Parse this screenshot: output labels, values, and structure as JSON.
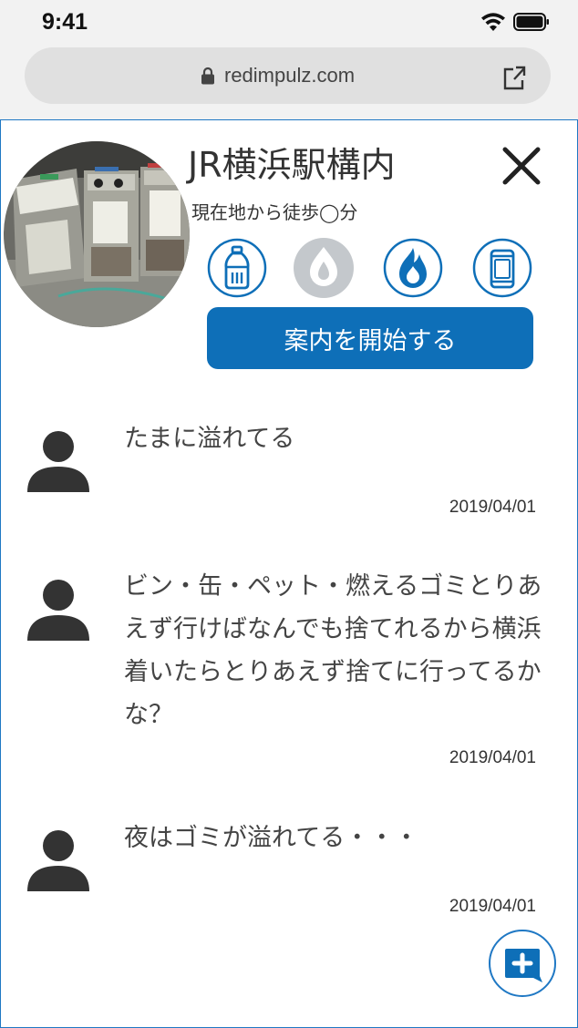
{
  "status_bar": {
    "time": "9:41",
    "icons": [
      "wifi-icon",
      "battery-icon"
    ]
  },
  "browser": {
    "url": "redimpulz.com",
    "icons": [
      "lock-icon",
      "share-icon"
    ]
  },
  "spot": {
    "name": "JR横浜駅構内",
    "walk_time": "現在地から徒歩◯分",
    "photo_icon": "trash-bins-photo",
    "trash_types": [
      {
        "icon": "pet-bottle-icon",
        "available": true
      },
      {
        "icon": "non-burnable-icon",
        "available": false
      },
      {
        "icon": "burnable-icon",
        "available": true
      },
      {
        "icon": "can-icon",
        "available": true
      }
    ],
    "start_button": "案内を開始する",
    "colors": {
      "accent": "#0e6fb8",
      "inactive": "#c4c8cc",
      "border": "#1f78c4"
    }
  },
  "reviews": [
    {
      "text": "たまに溢れてる",
      "date": "2019/04/01"
    },
    {
      "text": "ビン・缶・ペット・燃えるゴミとりあえず行けばなんでも捨てれるから横浜着いたらとりあえず捨てに行ってるかな？",
      "date": "2019/04/01"
    },
    {
      "text": "夜はゴミが溢れてる・・・",
      "date": "2019/04/01"
    }
  ],
  "add_review_icon": "add-comment-icon"
}
